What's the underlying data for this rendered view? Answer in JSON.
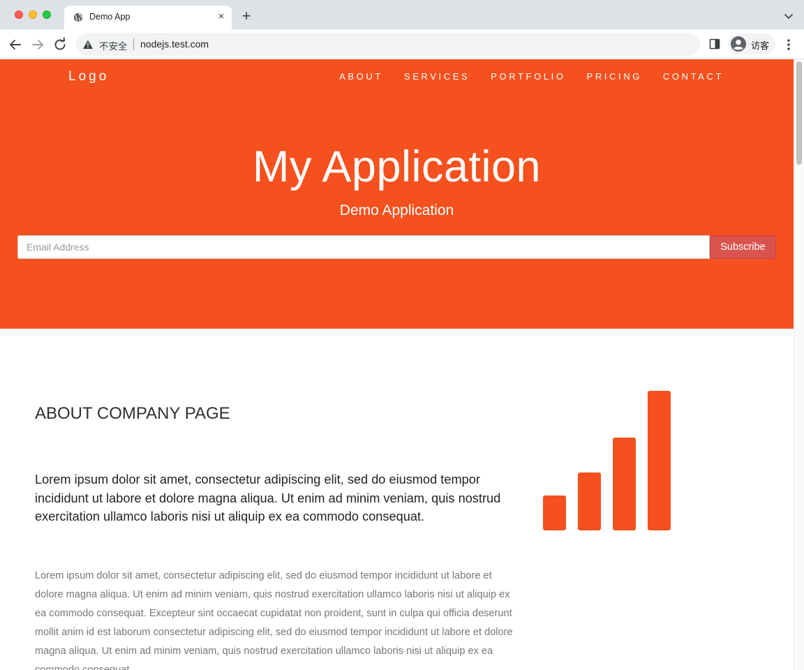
{
  "browser": {
    "tab_title": "Demo App",
    "security_label": "不安全",
    "url": "nodejs.test.com",
    "profile_label": "访客",
    "tab_close_glyph": "×",
    "new_tab_glyph": "+"
  },
  "page": {
    "logo": "Logo",
    "nav": [
      "ABOUT",
      "SERVICES",
      "PORTFOLIO",
      "PRICING",
      "CONTACT"
    ],
    "hero": {
      "title": "My Application",
      "subtitle": "Demo Application",
      "email_placeholder": "Email Address",
      "subscribe_label": "Subscribe"
    },
    "about": {
      "title": "ABOUT COMPANY PAGE",
      "lead": "Lorem ipsum dolor sit amet, consectetur adipiscing elit, sed do eiusmod tempor incididunt ut labore et dolore magna aliqua. Ut enim ad minim veniam, quis nostrud exercitation ullamco laboris nisi ut aliquip ex ea commodo consequat.",
      "body": "Lorem ipsum dolor sit amet, consectetur adipiscing elit, sed do eiusmod tempor incididunt ut labore et dolore magna aliqua. Ut enim ad minim veniam, quis nostrud exercitation ullamco laboris nisi ut aliquip ex ea commodo consequat. Excepteur sint occaecat cupidatat non proident, sunt in culpa qui officia deserunt mollit anim id est laborum consectetur adipiscing elit, sed do eiusmod tempor incididunt ut labore et dolore magna aliqua. Ut enim ad minim veniam, quis nostrud exercitation ullamco laboris nisi ut aliquip ex ea commodo consequat."
    }
  },
  "icons": {
    "tab_favicon": "globe-icon",
    "back": "arrow-left-icon",
    "forward": "arrow-right-icon",
    "reload": "reload-icon",
    "security": "warning-triangle-icon",
    "side_panel": "side-panel-icon",
    "profile": "person-avatar-icon",
    "menu": "kebab-menu-icon",
    "tab_list": "chevron-down-icon",
    "about_graphic": "signal-bars-icon"
  },
  "colors": {
    "brand_orange": "#f4511e",
    "subscribe_red": "#d9534f",
    "tabstrip_gray": "#dee1e6"
  }
}
